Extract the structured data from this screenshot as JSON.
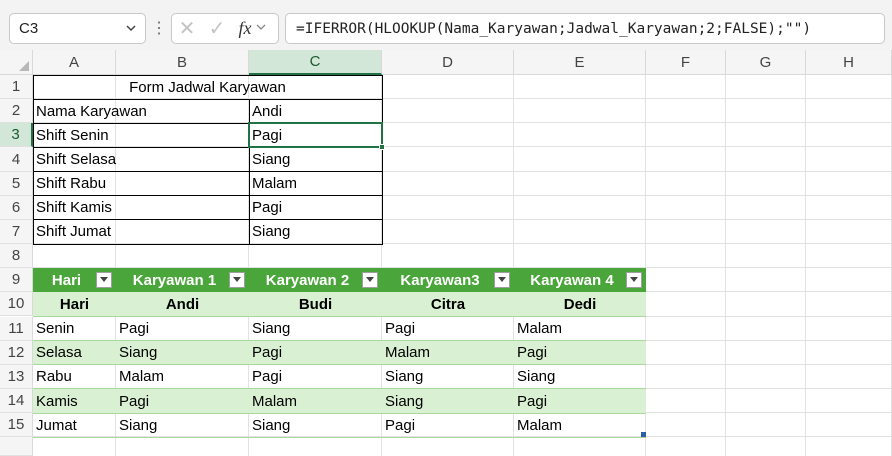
{
  "formula_bar": {
    "name_box": "C3",
    "name_box_chevron": "chevron-down-icon",
    "cancel_icon": "✕",
    "enter_icon": "✓",
    "fx_label": "fx",
    "formula": "=IFERROR(HLOOKUP(Nama_Karyawan;Jadwal_Karyawan;2;FALSE);\"\")"
  },
  "columns": [
    "A",
    "B",
    "C",
    "D",
    "E",
    "F",
    "G",
    "H"
  ],
  "rows": [
    "1",
    "2",
    "3",
    "4",
    "5",
    "6",
    "7",
    "8",
    "9",
    "10",
    "11",
    "12",
    "13",
    "14",
    "15"
  ],
  "selected_cell": "C3",
  "form": {
    "title": "Form Jadwal Karyawan",
    "rows": [
      {
        "label": "Nama Karyawan",
        "value": "Andi"
      },
      {
        "label": "Shift Senin",
        "value": "Pagi"
      },
      {
        "label": "Shift Selasa",
        "value": "Siang"
      },
      {
        "label": "Shift Rabu",
        "value": "Malam"
      },
      {
        "label": "Shift Kamis",
        "value": "Pagi"
      },
      {
        "label": "Shift Jumat",
        "value": "Siang"
      }
    ]
  },
  "table": {
    "header_color": "#4aa63a",
    "band_color": "#d9f0d3",
    "headers": [
      "Hari",
      "Karyawan 1",
      "Karyawan 2",
      "Karyawan3",
      "Karyawan 4"
    ],
    "name_row": [
      "Hari",
      "Andi",
      "Budi",
      "Citra",
      "Dedi"
    ],
    "data": [
      [
        "Senin",
        "Pagi",
        "Siang",
        "Pagi",
        "Malam"
      ],
      [
        "Selasa",
        "Siang",
        "Pagi",
        "Malam",
        "Pagi"
      ],
      [
        "Rabu",
        "Malam",
        "Pagi",
        "Siang",
        "Siang"
      ],
      [
        "Kamis",
        "Pagi",
        "Malam",
        "Siang",
        "Pagi"
      ],
      [
        "Jumat",
        "Siang",
        "Siang",
        "Pagi",
        "Malam"
      ]
    ]
  }
}
